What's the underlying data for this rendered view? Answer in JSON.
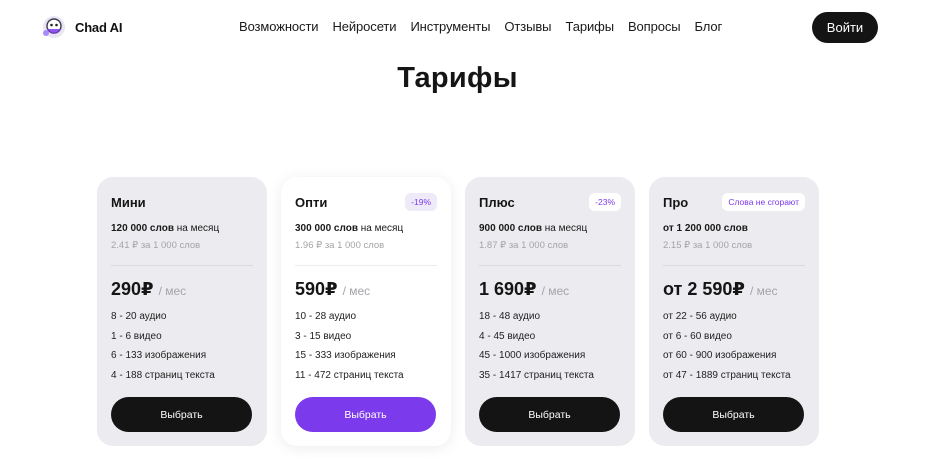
{
  "header": {
    "logo_text": "Chad AI",
    "nav": [
      "Возможности",
      "Нейросети",
      "Инструменты",
      "Отзывы",
      "Тарифы",
      "Вопросы",
      "Блог"
    ],
    "login_label": "Войти"
  },
  "page": {
    "title": "Тарифы"
  },
  "plans": [
    {
      "name": "Мини",
      "badge": "",
      "words_bold": "120 000 слов",
      "words_rest": " на месяц",
      "rate": "2.41 ₽ за 1 000 слов",
      "price": "290₽",
      "per": "/ мес",
      "features": [
        "8 - 20 аудио",
        "1 - 6 видео",
        "6 - 133 изображения",
        "4 - 188 страниц текста"
      ],
      "button": "Выбрать"
    },
    {
      "name": "Опти",
      "badge": "-19%",
      "words_bold": "300 000 слов",
      "words_rest": " на месяц",
      "rate": "1.96 ₽ за 1 000 слов",
      "price": "590₽",
      "per": "/ мес",
      "features": [
        "10 - 28 аудио",
        "3 - 15 видео",
        "15 - 333 изображения",
        "11 - 472 страниц текста"
      ],
      "button": "Выбрать"
    },
    {
      "name": "Плюс",
      "badge": "-23%",
      "words_bold": "900 000 слов",
      "words_rest": " на месяц",
      "rate": "1.87 ₽ за 1 000 слов",
      "price": "1 690₽",
      "per": "/ мес",
      "features": [
        "18 - 48 аудио",
        "4 - 45 видео",
        "45 - 1000 изображения",
        "35 - 1417 страниц текста"
      ],
      "button": "Выбрать"
    },
    {
      "name": "Про",
      "badge": "Слова не сгорают",
      "words_bold": "от 1 200 000 слов",
      "words_rest": "",
      "rate": "2.15 ₽ за 1 000 слов",
      "price": "от 2 590₽",
      "per": "/ мес",
      "features": [
        "от 22 - 56 аудио",
        "от 6 - 60 видео",
        "от 60 - 900 изображения",
        "от 47 - 1889 страниц текста"
      ],
      "button": "Выбрать"
    }
  ],
  "colors": {
    "accent": "#7c3aed",
    "dark": "#141414",
    "card_bg": "#ececf0"
  },
  "icons": {
    "logo": "chad-ai-logo-icon"
  }
}
